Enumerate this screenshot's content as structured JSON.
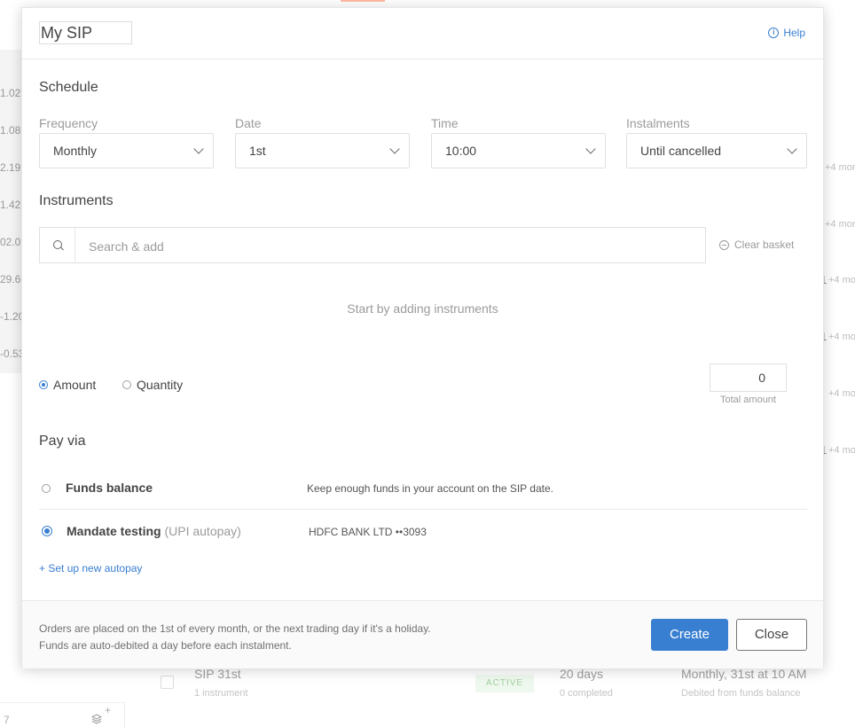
{
  "background": {
    "left_values": [
      "1.02",
      "1.08",
      "2.19",
      "1.42",
      "02.09",
      "29.60",
      "-1.20",
      "-0.53"
    ],
    "right_notes": [
      "+4 more",
      "+4 more",
      "+4 mo",
      "+4 mo",
      "+4 mo",
      "+4 mo"
    ],
    "right_counts": [
      "1",
      "1",
      "1"
    ],
    "row": {
      "name": "SIP 31st",
      "sub": "1 instrument",
      "status": "ACTIVE",
      "days": "20 days",
      "days_sub": "0 completed",
      "frequency": "Monthly, 31st at 10 AM",
      "frequency_sub": "Debited from funds balance"
    },
    "footer_count": "7",
    "footer_plus": "+"
  },
  "modal": {
    "title": "My SIP",
    "help_label": "Help",
    "schedule": {
      "heading": "Schedule",
      "frequency": {
        "label": "Frequency",
        "value": "Monthly"
      },
      "date": {
        "label": "Date",
        "value": "1st"
      },
      "time": {
        "label": "Time",
        "value": "10:00"
      },
      "instalments": {
        "label": "Instalments",
        "value": "Until cancelled"
      }
    },
    "instruments": {
      "heading": "Instruments",
      "search_placeholder": "Search & add",
      "clear_label": "Clear basket",
      "empty_text": "Start by adding instruments"
    },
    "mode": {
      "amount_label": "Amount",
      "quantity_label": "Quantity",
      "selected": "Amount",
      "total_value": "0",
      "total_label": "Total amount"
    },
    "pay_via": {
      "heading": "Pay via",
      "options": [
        {
          "name": "Funds balance",
          "tag": "",
          "description": "Keep enough funds in your account on the SIP date.",
          "selected": false
        },
        {
          "name": "Mandate testing",
          "tag": "(UPI autopay)",
          "description": "HDFC BANK LTD ••3093",
          "selected": true
        }
      ],
      "setup_link": "+ Set up new autopay"
    },
    "footer": {
      "note_line1": "Orders are placed on the 1st of every month, or the next trading day if it's a holiday.",
      "note_line2": "Funds are auto-debited a day before each instalment.",
      "create_label": "Create",
      "close_label": "Close"
    }
  },
  "colors": {
    "accent": "#387ed1",
    "text": "#444444",
    "muted": "#9b9b9b",
    "status_active": "#9fcf9f"
  }
}
